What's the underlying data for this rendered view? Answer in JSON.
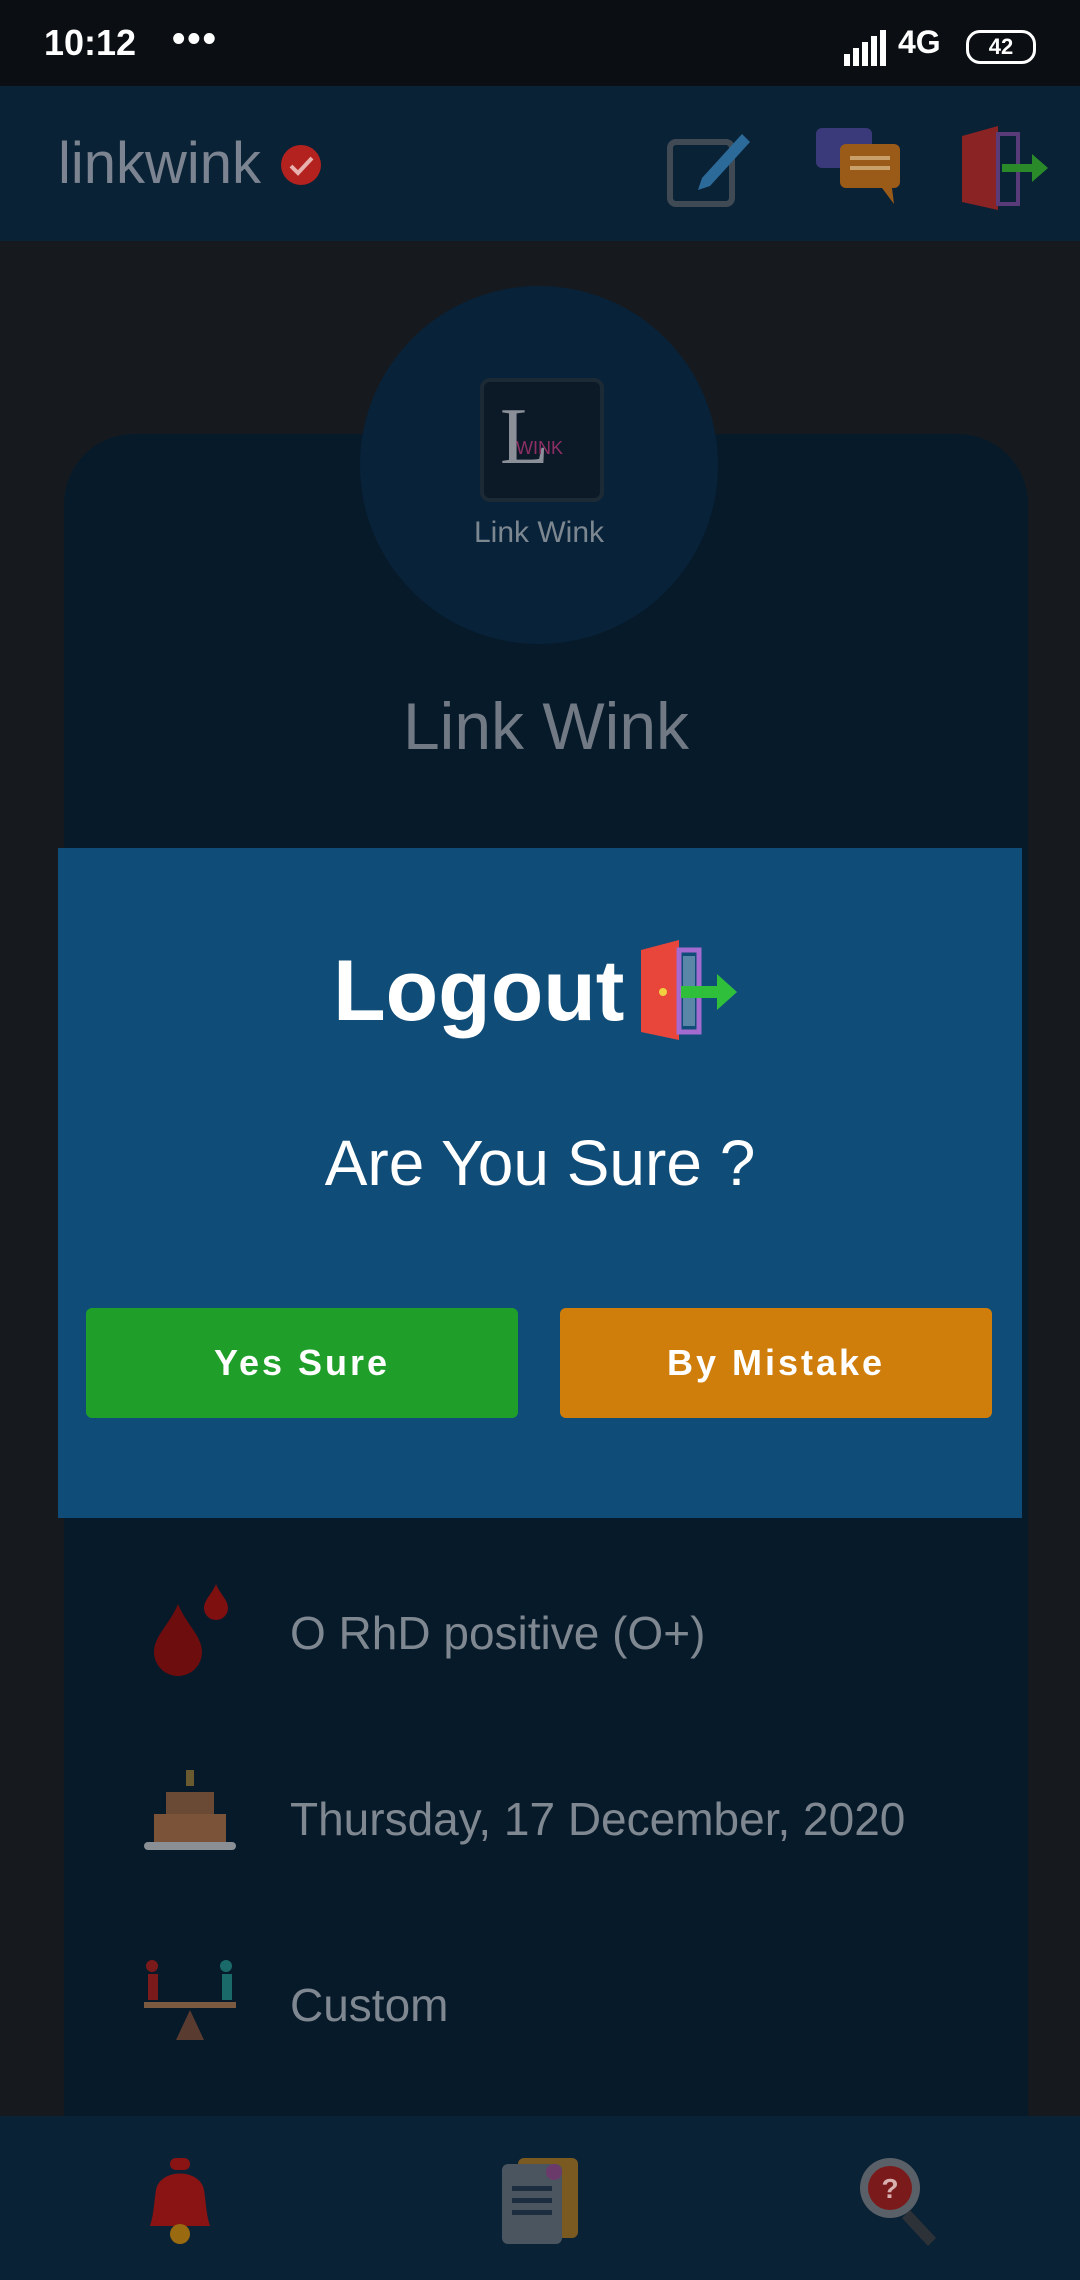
{
  "status_bar": {
    "time": "10:12",
    "dots": "•••",
    "network": "4G",
    "battery": "42"
  },
  "app_bar": {
    "brand": "linkwink"
  },
  "profile": {
    "logo_letter": "L",
    "logo_word": "WINK",
    "avatar_name": "Link Wink",
    "name": "Link Wink"
  },
  "info": {
    "blood_group": "O RhD positive (O+)",
    "birthday": "Thursday, 17 December, 2020",
    "gender": "Custom"
  },
  "dialog": {
    "title": "Logout",
    "question": "Are You Sure ?",
    "yes_label": "Yes Sure",
    "no_label": "By Mistake"
  },
  "colors": {
    "dialog_bg": "#0f4c78",
    "yes_button": "#1f9f2a",
    "no_button": "#cf7e0c",
    "app_bar": "#0a2236"
  }
}
